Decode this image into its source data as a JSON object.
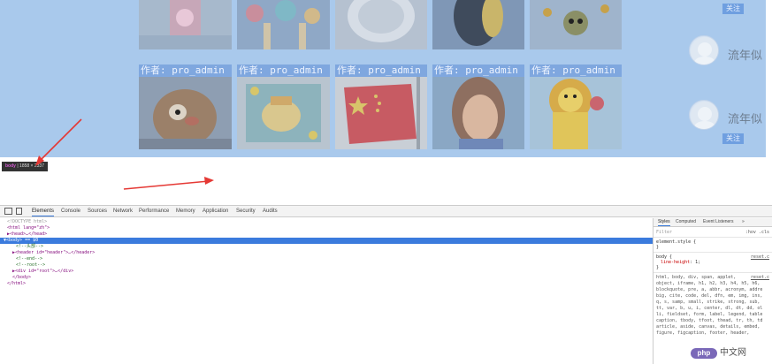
{
  "page": {
    "author_labels": [
      "作者: pro_admin",
      "作者: pro_admin",
      "作者: pro_admin",
      "作者: pro_admin",
      "作者: pro_admin"
    ],
    "users": [
      {
        "name": "流年似",
        "follow_label": "关注"
      },
      {
        "name": "流年似",
        "follow_label": "关注"
      }
    ],
    "top_follow_label": "关注",
    "overlay_color": "#a9c9ec"
  },
  "inspect_tooltip": {
    "tag": "body",
    "separator": "|",
    "size": "1858 × 2337"
  },
  "devtools": {
    "tabs": [
      "Elements",
      "Console",
      "Sources",
      "Network",
      "Performance",
      "Memory",
      "Application",
      "Security",
      "Audits"
    ],
    "active_tab": "Elements",
    "dom_tree": {
      "doctype": "<!DOCTYPE html>",
      "html_open": "<html lang=\"zh\">",
      "head": "▶<head>…</head>",
      "body_open": "▼<body> == $0",
      "comment_header": "<!--头部-->",
      "header": "▶<header id=\"header\">…</header>",
      "comment_end": "<!--end-->",
      "comment_root": "<!--root-->",
      "root_div": "▶<div id=\"root\">…</div>",
      "body_close": "</body>",
      "html_close": "</html>"
    },
    "styles": {
      "tabs": [
        "Styles",
        "Computed",
        "Event Listeners",
        "»"
      ],
      "active_tab": "Styles",
      "filter_placeholder": "Filter",
      "filter_right": ":hov  .cls",
      "element_style": [
        "element.style {",
        "}"
      ],
      "body_rule": {
        "selector": "body {",
        "source": "reset.c",
        "property": "line-height",
        "value": "1;",
        "close": "}"
      },
      "reset_selectors_source": "reset.c",
      "reset_selectors": [
        "html, body, div, span, applet,",
        "object, iframe, h1, h2, h3, h4, h5, h6,",
        "blockquote, pre, a, abbr, acronym, addre",
        "big, cite, code, del, dfn, em, img, ins,",
        "q, s, samp, small, strike, strong, sub,",
        "tt, var, b, u, i, center, dl, dt, dd, ol",
        "li, fieldset, form, label, legend, table",
        "caption, tbody, tfoot, thead, tr, th, td",
        "article, aside, canvas, details, embed,",
        "figure, figcaption, footer, header,"
      ]
    }
  },
  "watermark": {
    "logo": "php",
    "text": "中文网"
  }
}
